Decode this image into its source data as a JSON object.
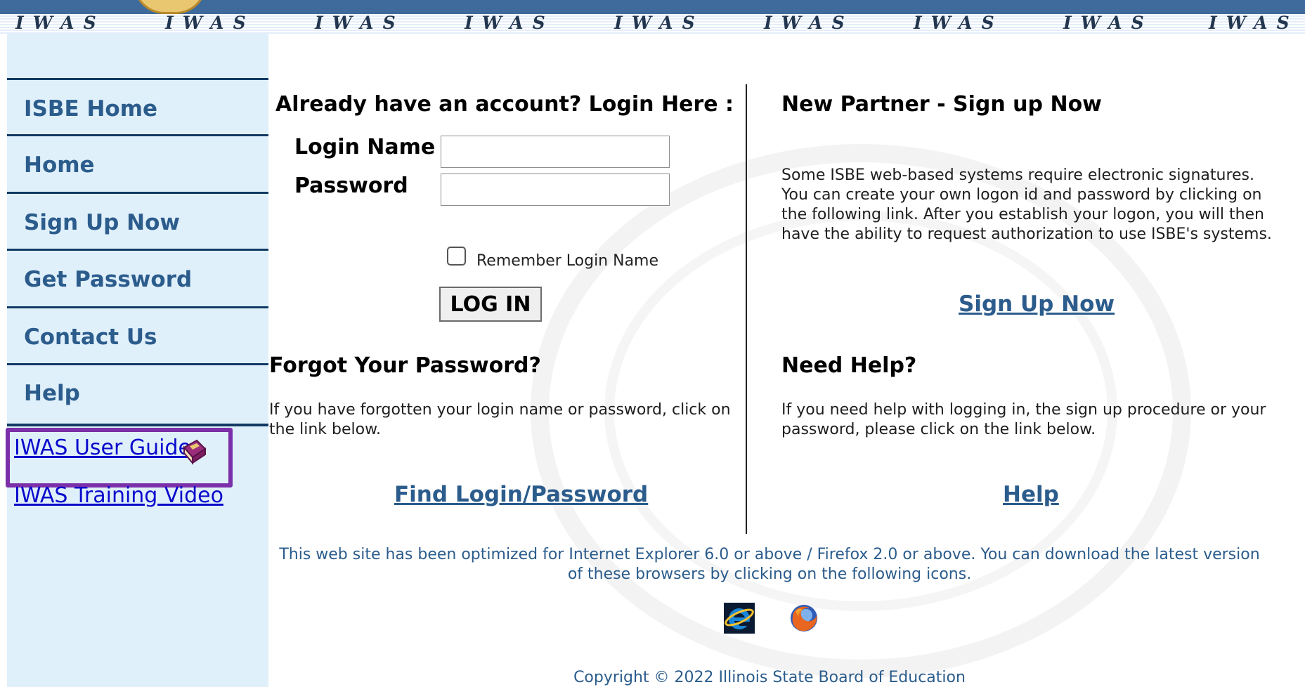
{
  "banner": {
    "words": [
      "IWAS",
      "IWAS",
      "IWAS",
      "IWAS",
      "IWAS",
      "IWAS",
      "IWAS",
      "IWAS",
      "IWAS"
    ]
  },
  "sidebar": {
    "nav": [
      {
        "label": "ISBE Home"
      },
      {
        "label": "Home"
      },
      {
        "label": "Sign Up Now"
      },
      {
        "label": "Get Password"
      },
      {
        "label": "Contact Us"
      },
      {
        "label": "Help"
      }
    ],
    "links": {
      "user_guide": "IWAS User Guide",
      "training_video": "IWAS Training Video"
    },
    "highlight_color": "#7b2fa8"
  },
  "login": {
    "heading": "Already have an account?  Login Here :",
    "login_name_label": "Login Name",
    "login_name_value": "",
    "password_label": "Password",
    "password_value": "",
    "remember_label": "Remember Login Name",
    "remember_checked": false,
    "button": "LOG IN"
  },
  "signup": {
    "heading": "New Partner - Sign up Now",
    "text": "Some ISBE web-based systems require electronic signatures. You can create your own logon id and password by clicking on the following link. After you establish your logon, you will then have the ability to request authorization to use ISBE's systems.",
    "link": "Sign Up Now"
  },
  "forgot": {
    "heading": "Forgot Your Password?",
    "text": "If you have forgotten your login name or password, click on the link below.",
    "link": "Find Login/Password"
  },
  "help": {
    "heading": "Need Help?",
    "text": "If you need help with logging in, the sign up procedure or your password, please click on the link below.",
    "link": "Help"
  },
  "footer": {
    "notice": "This web site has been optimized for Internet Explorer 6.0 or above / Firefox 2.0 or above. You can download the latest version of these browsers by clicking on the following icons.",
    "icons": [
      "internet-explorer-icon",
      "firefox-icon"
    ],
    "copyright": "Copyright © 2022 Illinois State Board of Education"
  },
  "colors": {
    "banner": "#3f6b9c",
    "sidebar_bg": "#e0f0fb",
    "nav_text": "#2b5c8c",
    "nav_border": "#123a63",
    "link": "#0a0acc"
  }
}
